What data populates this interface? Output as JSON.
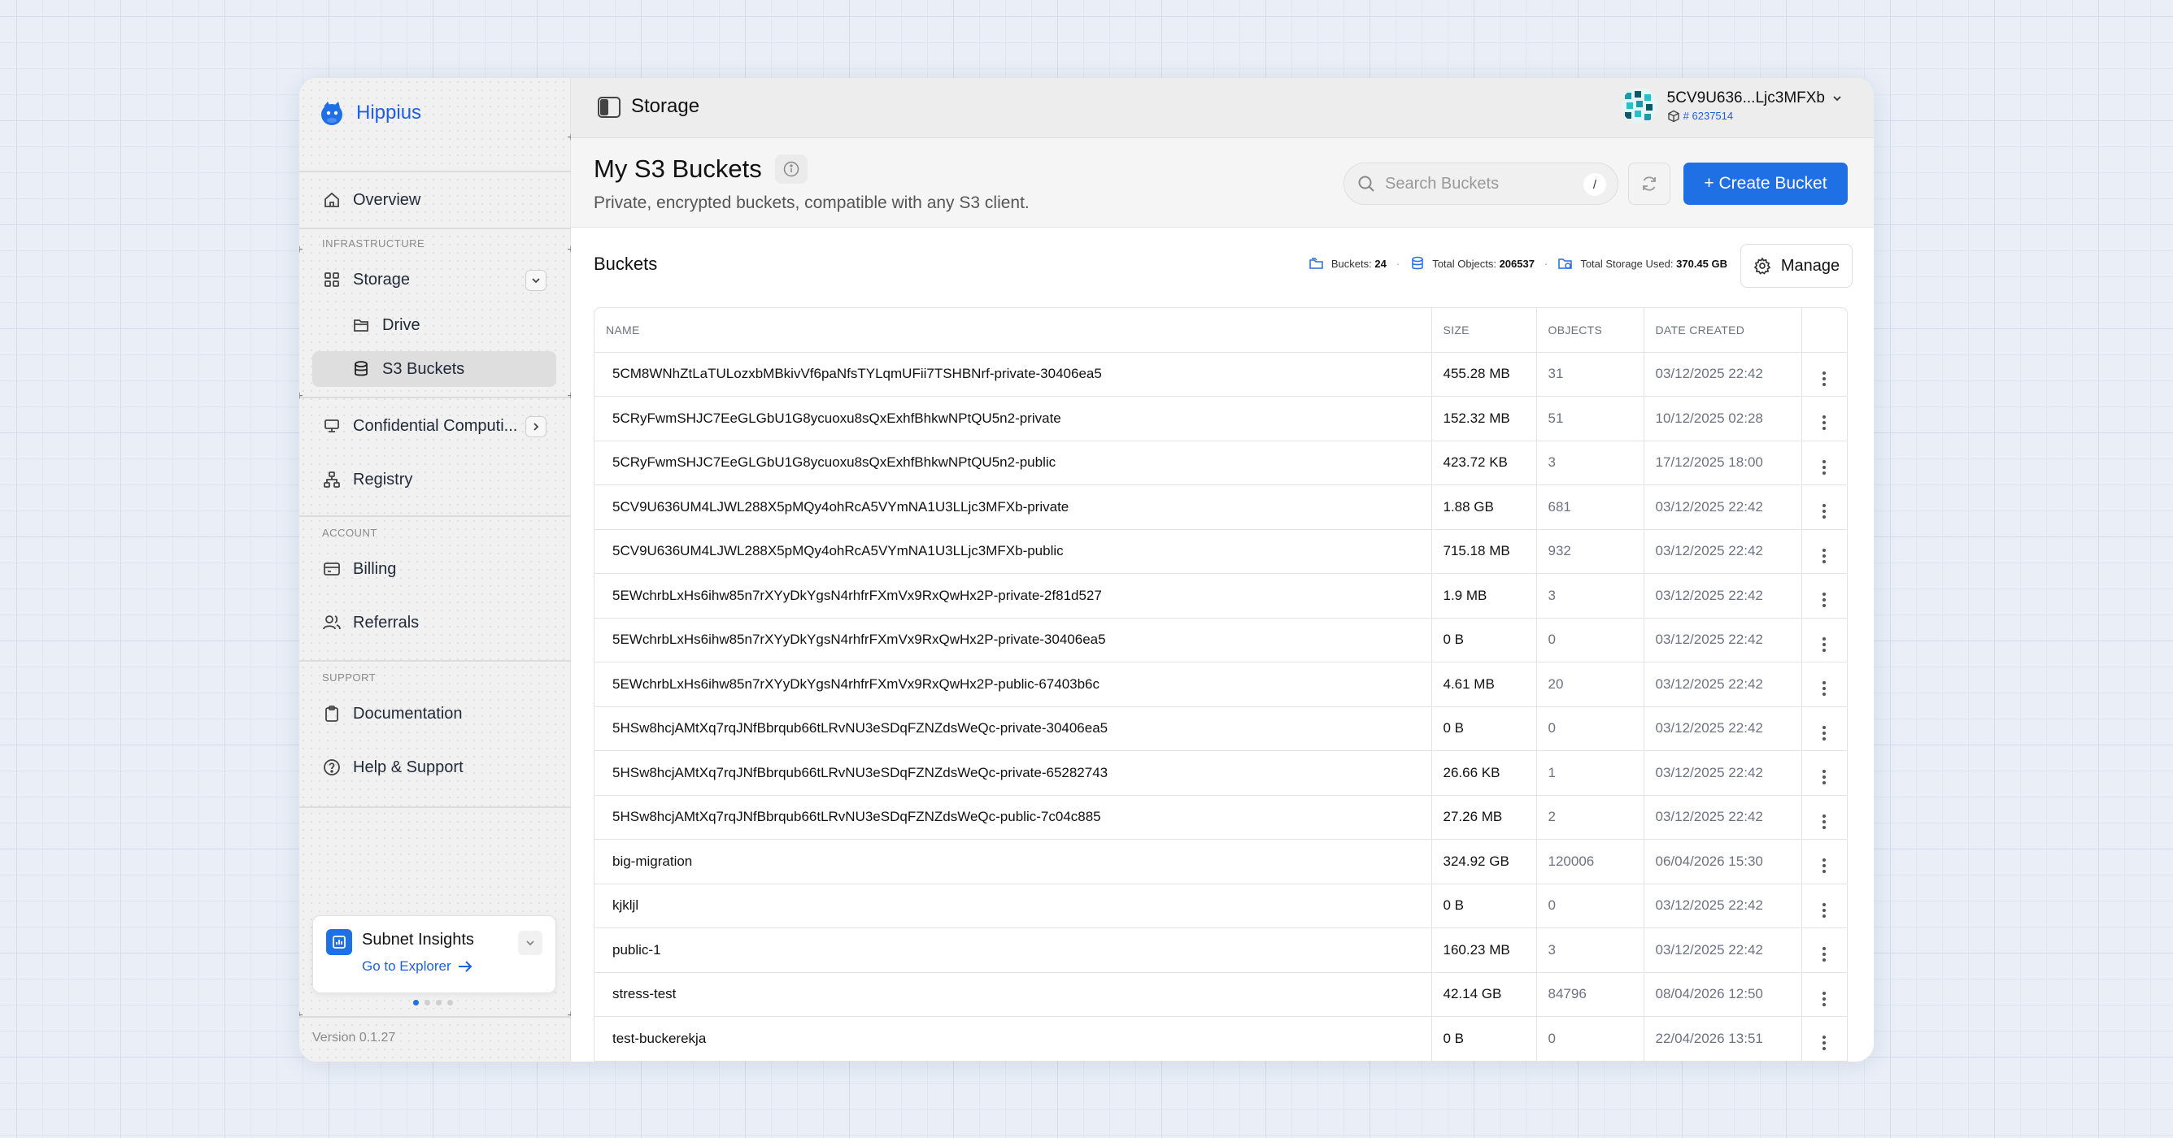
{
  "brand": {
    "name": "Hippius"
  },
  "sidebar": {
    "items": [
      {
        "label": "Overview"
      },
      {
        "label": "Storage"
      },
      {
        "label": "Drive"
      },
      {
        "label": "S3 Buckets"
      },
      {
        "label": "Confidential Computi..."
      },
      {
        "label": "Registry"
      },
      {
        "label": "Billing"
      },
      {
        "label": "Referrals"
      },
      {
        "label": "Documentation"
      },
      {
        "label": "Help & Support"
      }
    ],
    "sections": {
      "infrastructure": "INFRASTRUCTURE",
      "account": "ACCOUNT",
      "support": "SUPPORT"
    },
    "insights": {
      "title": "Subnet Insights",
      "link": "Go to Explorer"
    },
    "version": "Version 0.1.27"
  },
  "topbar": {
    "page_title": "Storage",
    "user_address": "5CV9U636...Ljc3MFXb",
    "user_id": "# 6237514"
  },
  "header": {
    "title": "My S3 Buckets",
    "subtitle": "Private, encrypted buckets, compatible with any S3 client.",
    "search_placeholder": "Search Buckets",
    "search_shortcut": "/",
    "create_label": "+ Create Bucket"
  },
  "buckets": {
    "label": "Buckets",
    "stats": {
      "buckets_label": "Buckets:",
      "buckets_value": "24",
      "objects_label": "Total Objects:",
      "objects_value": "206537",
      "storage_label": "Total Storage Used:",
      "storage_value": "370.45 GB"
    },
    "manage_label": "Manage",
    "columns": [
      "NAME",
      "SIZE",
      "OBJECTS",
      "DATE CREATED"
    ],
    "rows": [
      {
        "name": "5CM8WNhZtLaTULozxbMBkivVf6paNfsTYLqmUFii7TSHBNrf-private-30406ea5",
        "size": "455.28 MB",
        "objects": "31",
        "date": "03/12/2025 22:42"
      },
      {
        "name": "5CRyFwmSHJC7EeGLGbU1G8ycuoxu8sQxExhfBhkwNPtQU5n2-private",
        "size": "152.32 MB",
        "objects": "51",
        "date": "10/12/2025 02:28"
      },
      {
        "name": "5CRyFwmSHJC7EeGLGbU1G8ycuoxu8sQxExhfBhkwNPtQU5n2-public",
        "size": "423.72 KB",
        "objects": "3",
        "date": "17/12/2025 18:00"
      },
      {
        "name": "5CV9U636UM4LJWL288X5pMQy4ohRcA5VYmNA1U3LLjc3MFXb-private",
        "size": "1.88 GB",
        "objects": "681",
        "date": "03/12/2025 22:42"
      },
      {
        "name": "5CV9U636UM4LJWL288X5pMQy4ohRcA5VYmNA1U3LLjc3MFXb-public",
        "size": "715.18 MB",
        "objects": "932",
        "date": "03/12/2025 22:42"
      },
      {
        "name": "5EWchrbLxHs6ihw85n7rXYyDkYgsN4rhfrFXmVx9RxQwHx2P-private-2f81d527",
        "size": "1.9 MB",
        "objects": "3",
        "date": "03/12/2025 22:42"
      },
      {
        "name": "5EWchrbLxHs6ihw85n7rXYyDkYgsN4rhfrFXmVx9RxQwHx2P-private-30406ea5",
        "size": "0 B",
        "objects": "0",
        "date": "03/12/2025 22:42"
      },
      {
        "name": "5EWchrbLxHs6ihw85n7rXYyDkYgsN4rhfrFXmVx9RxQwHx2P-public-67403b6c",
        "size": "4.61 MB",
        "objects": "20",
        "date": "03/12/2025 22:42"
      },
      {
        "name": "5HSw8hcjAMtXq7rqJNfBbrqub66tLRvNU3eSDqFZNZdsWeQc-private-30406ea5",
        "size": "0 B",
        "objects": "0",
        "date": "03/12/2025 22:42"
      },
      {
        "name": "5HSw8hcjAMtXq7rqJNfBbrqub66tLRvNU3eSDqFZNZdsWeQc-private-65282743",
        "size": "26.66 KB",
        "objects": "1",
        "date": "03/12/2025 22:42"
      },
      {
        "name": "5HSw8hcjAMtXq7rqJNfBbrqub66tLRvNU3eSDqFZNZdsWeQc-public-7c04c885",
        "size": "27.26 MB",
        "objects": "2",
        "date": "03/12/2025 22:42"
      },
      {
        "name": "big-migration",
        "size": "324.92 GB",
        "objects": "120006",
        "date": "06/04/2026 15:30"
      },
      {
        "name": "kjkljl",
        "size": "0 B",
        "objects": "0",
        "date": "03/12/2025 22:42"
      },
      {
        "name": "public-1",
        "size": "160.23 MB",
        "objects": "3",
        "date": "03/12/2025 22:42"
      },
      {
        "name": "stress-test",
        "size": "42.14 GB",
        "objects": "84796",
        "date": "08/04/2026 12:50"
      },
      {
        "name": "test-buckerekja",
        "size": "0 B",
        "objects": "0",
        "date": "22/04/2026 13:51"
      }
    ]
  },
  "colors": {
    "accent": "#1f6fe5",
    "sidebar_bg": "#f1f1f1",
    "active_item": "#dedede"
  }
}
